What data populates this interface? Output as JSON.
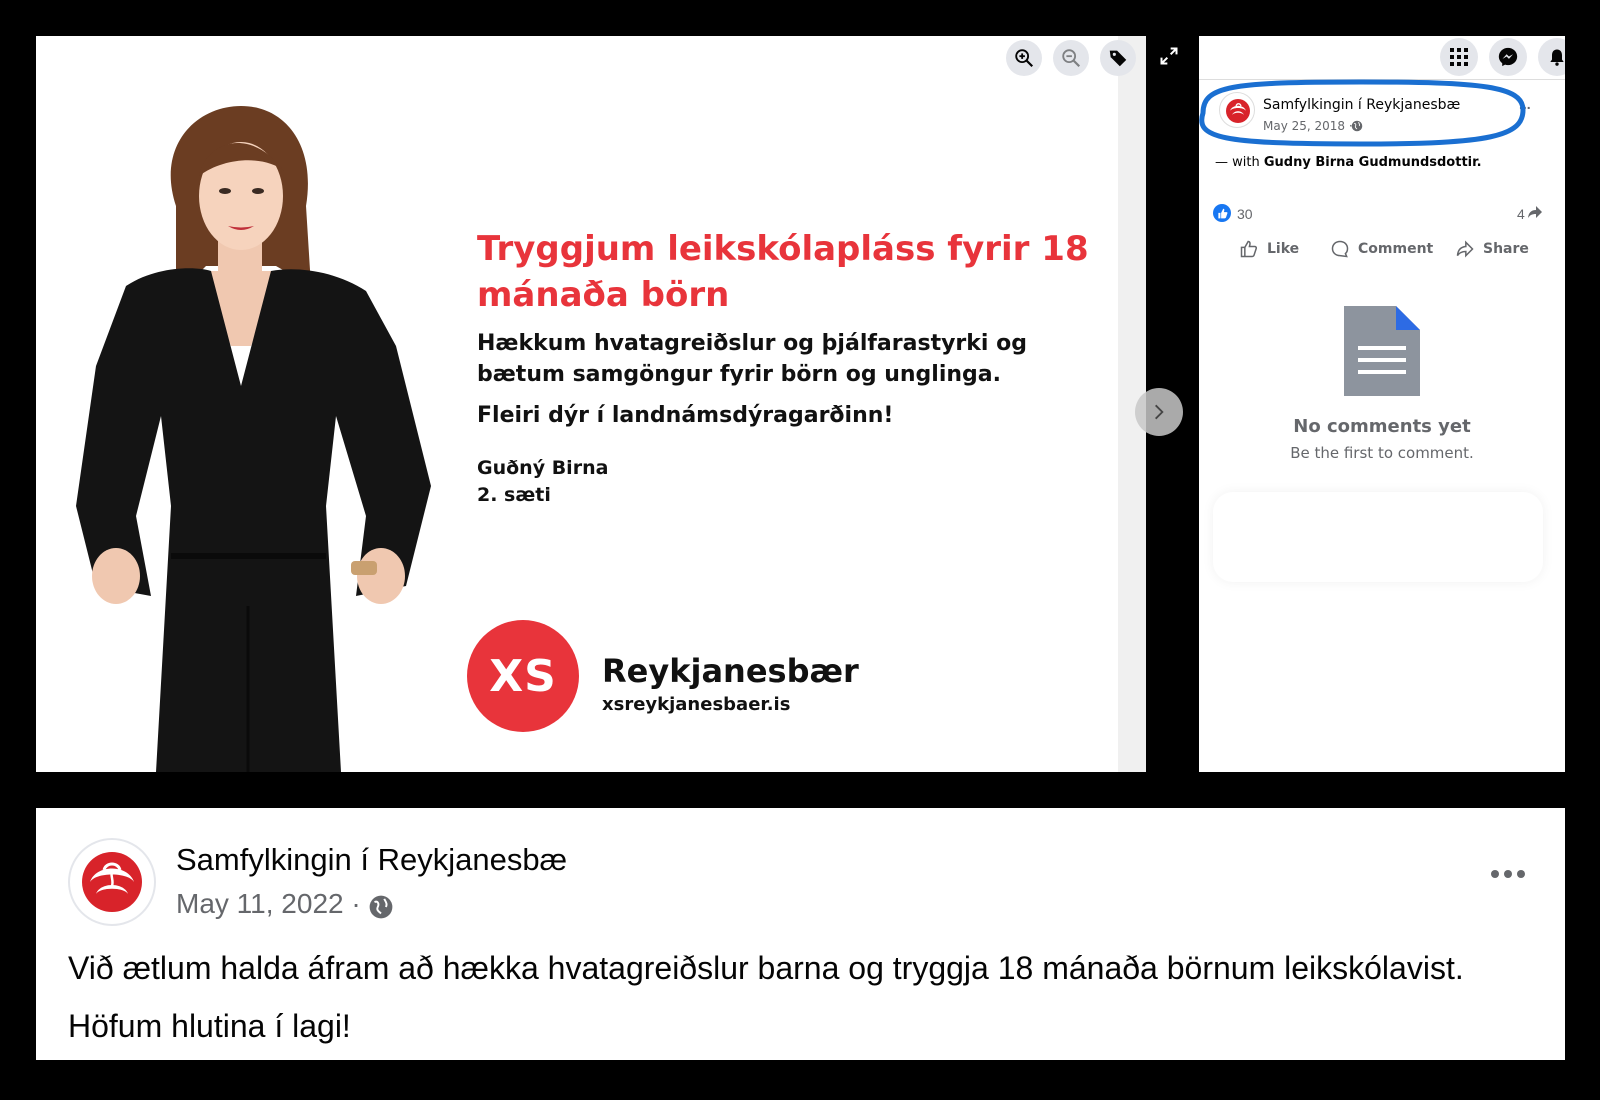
{
  "photo": {
    "headline": "Tryggjum leikskólapláss fyrir 18 mánaða börn",
    "subtext_1": "Hækkum hvatagreiðslur og þjálfarastyrki og bætum samgöngur fyrir börn og unglinga.",
    "subtext_2": "Fleiri dýr í landnámsdýragarðinn!",
    "candidate_name": "Guðný Birna",
    "candidate_seat": "2. sæti",
    "logo_text": "XS",
    "brand_name": "Reykjanesbær",
    "brand_url": "xsreykjanesbaer.is",
    "icons": [
      "zoom-in-icon",
      "zoom-out-icon",
      "tag-icon",
      "expand-icon",
      "chevron-right-icon"
    ],
    "colors": {
      "accent_red": "#e8343b",
      "text_dark": "#111111"
    }
  },
  "side_panel": {
    "page_name": "Samfylkingin í Reykjanesbæ",
    "date": "May 25, 2018 ·",
    "more": "...",
    "with_prefix": "— with",
    "with_name": "Gudny Birna Gudmundsdottir.",
    "like_count": "30",
    "share_count": "4",
    "actions": {
      "like": "Like",
      "comment": "Comment",
      "share": "Share"
    },
    "no_comments_title": "No comments yet",
    "no_comments_sub": "Be the first to comment.",
    "highlight_color": "#1a6fd1"
  },
  "bottom_post": {
    "page_name": "Samfylkingin í Reykjanesbæ",
    "date": "May 11, 2022 ·",
    "text_1": "Við ætlum halda áfram að hækka hvatagreiðslur barna og tryggja 18 mánaða börnum leikskólavist.",
    "text_2": "Höfum hlutina í lagi!"
  }
}
